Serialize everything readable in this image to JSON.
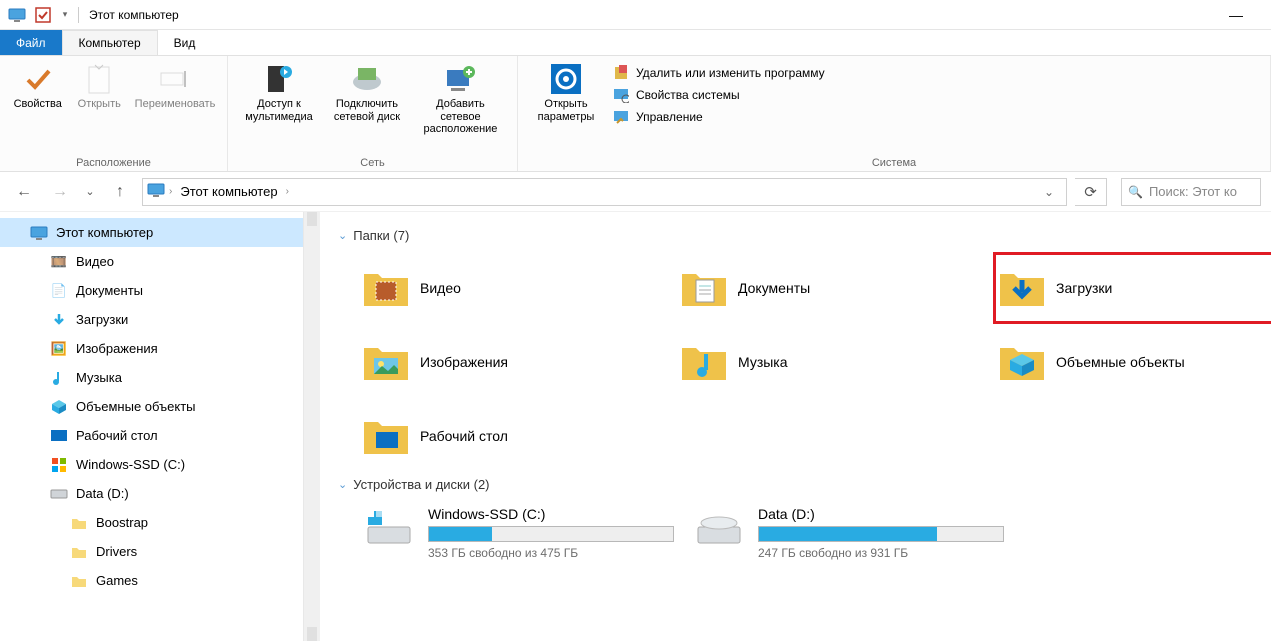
{
  "window": {
    "title": "Этот компьютер"
  },
  "tabs": {
    "file": "Файл",
    "computer": "Компьютер",
    "view": "Вид"
  },
  "ribbon": {
    "location": {
      "label": "Расположение",
      "properties": "Свойства",
      "open": "Открыть",
      "rename": "Переименовать"
    },
    "network": {
      "label": "Сеть",
      "media_access": "Доступ к\nмультимедиа",
      "map_drive": "Подключить\nсетевой диск",
      "add_location": "Добавить сетевое\nрасположение"
    },
    "system": {
      "label": "Система",
      "open_settings": "Открыть\nпараметры",
      "uninstall": "Удалить или изменить программу",
      "sys_props": "Свойства системы",
      "manage": "Управление"
    }
  },
  "address": {
    "this_pc": "Этот компьютер",
    "search_placeholder": "Поиск: Этот ко"
  },
  "tree": {
    "this_pc": "Этот компьютер",
    "videos": "Видео",
    "documents": "Документы",
    "downloads": "Загрузки",
    "pictures": "Изображения",
    "music": "Музыка",
    "objects3d": "Объемные объекты",
    "desktop": "Рабочий стол",
    "cdrive": "Windows-SSD (C:)",
    "ddrive": "Data (D:)",
    "boostrap": "Boostrap",
    "drivers": "Drivers",
    "games": "Games"
  },
  "sections": {
    "folders": "Папки (7)",
    "devices": "Устройства и диски (2)"
  },
  "folders": {
    "videos": "Видео",
    "documents": "Документы",
    "downloads": "Загрузки",
    "pictures": "Изображения",
    "music": "Музыка",
    "objects3d": "Объемные объекты",
    "desktop": "Рабочий стол"
  },
  "drives": {
    "c": {
      "name": "Windows-SSD (C:)",
      "free": "353 ГБ свободно из 475 ГБ",
      "fill_pct": 26
    },
    "d": {
      "name": "Data (D:)",
      "free": "247 ГБ свободно из 931 ГБ",
      "fill_pct": 73
    }
  }
}
